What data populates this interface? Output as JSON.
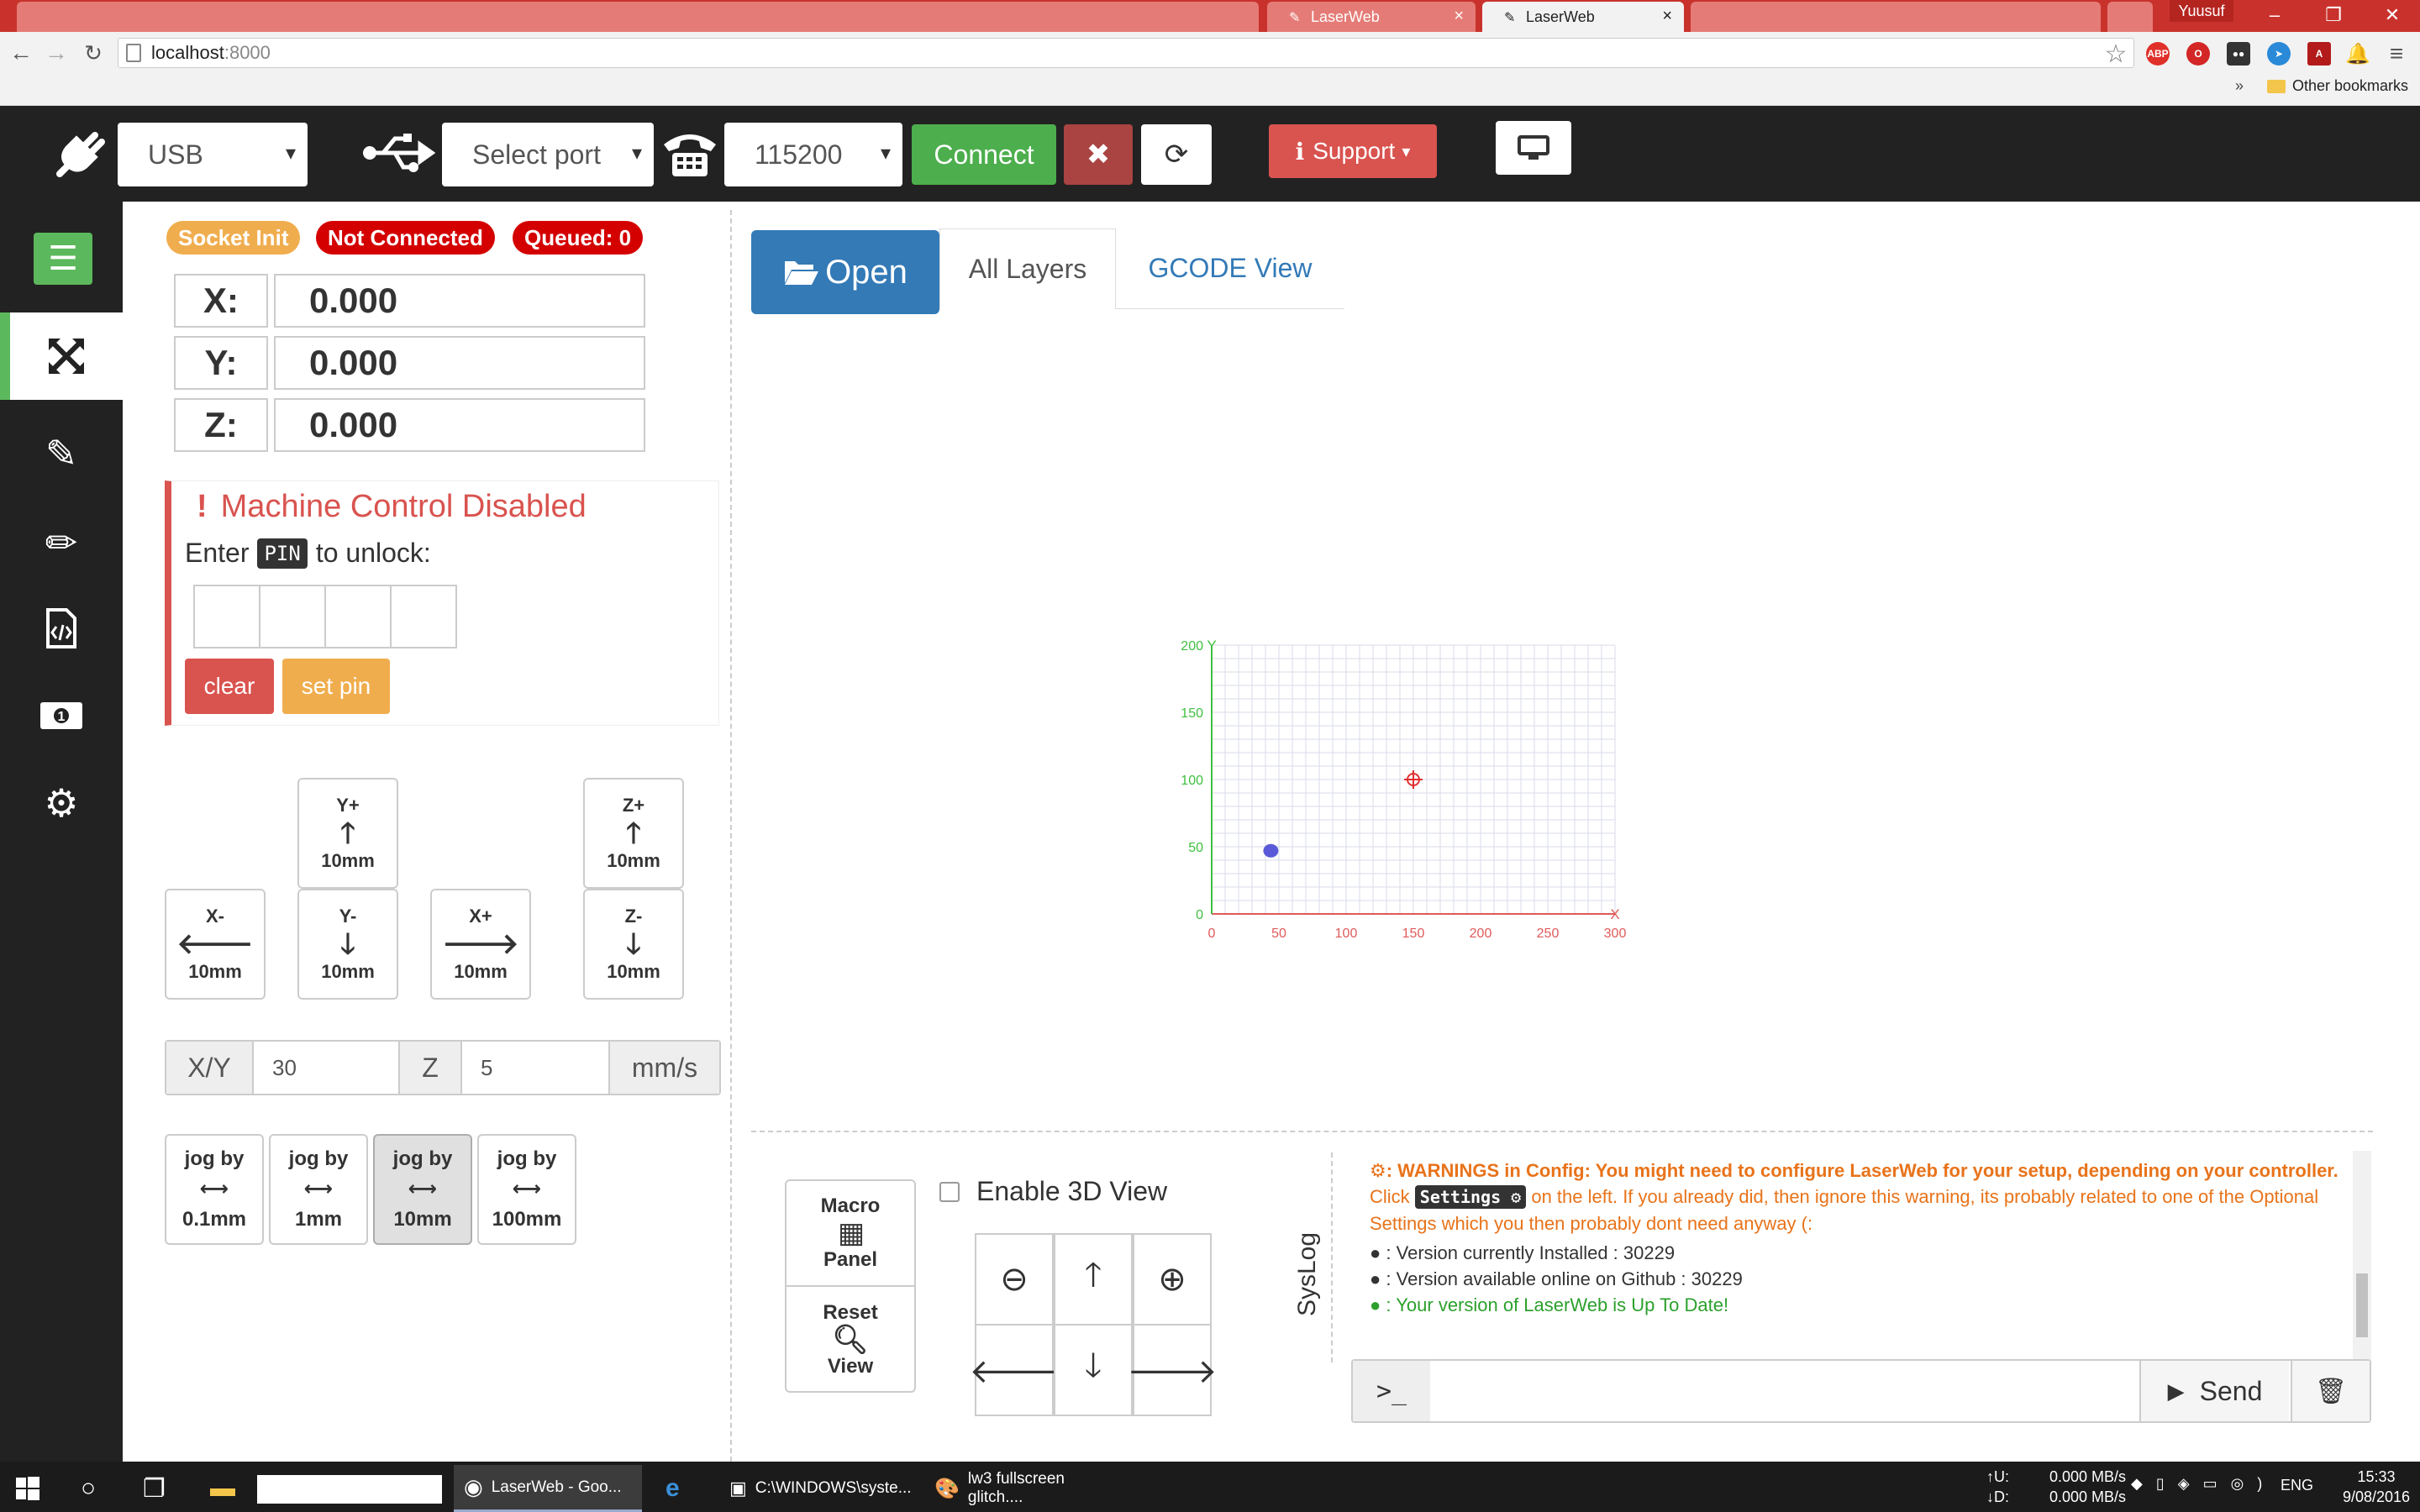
{
  "browser": {
    "profile": "Yuusuf",
    "tabs": [
      {
        "title": ""
      },
      {
        "title": "LaserWeb"
      },
      {
        "title": "LaserWeb"
      },
      {
        "title": ""
      }
    ],
    "url_host": "localhost",
    "url_port": ":8000",
    "other_bookmarks": "Other bookmarks",
    "extensions": [
      "ABP"
    ]
  },
  "topbar": {
    "connection_type": "USB",
    "port": "Select port",
    "baud": "115200",
    "connect_label": "Connect",
    "support_label": "Support"
  },
  "status": {
    "socket": "Socket Init",
    "connection": "Not Connected",
    "queued": "Queued: 0"
  },
  "dro": {
    "x_label": "X:",
    "x_value": "0.000",
    "y_label": "Y:",
    "y_value": "0.000",
    "z_label": "Z:",
    "z_value": "0.000"
  },
  "lock": {
    "title": "Machine Control Disabled",
    "prompt_pre": "Enter",
    "pin_tag": "PIN",
    "prompt_post": "to unlock:",
    "clear_label": "clear",
    "setpin_label": "set pin"
  },
  "jog": {
    "y_plus": {
      "axis": "Y+",
      "dist": "10mm"
    },
    "z_plus": {
      "axis": "Z+",
      "dist": "10mm"
    },
    "x_minus": {
      "axis": "X-",
      "dist": "10mm"
    },
    "y_minus": {
      "axis": "Y-",
      "dist": "10mm"
    },
    "x_plus": {
      "axis": "X+",
      "dist": "10mm"
    },
    "z_minus": {
      "axis": "Z-",
      "dist": "10mm"
    }
  },
  "speed": {
    "xy_label": "X/Y",
    "xy_value": "30",
    "z_label": "Z",
    "z_value": "5",
    "unit": "mm/s"
  },
  "jogby": {
    "label": "jog by",
    "options": [
      "0.1mm",
      "1mm",
      "10mm",
      "100mm"
    ],
    "selected": "10mm"
  },
  "main_tabs": {
    "open_label": "Open",
    "all_layers": "All Layers",
    "gcode_view": "GCODE View"
  },
  "chart_data": {
    "type": "scatter",
    "x_axis_label": "X",
    "y_axis_label": "Y",
    "xlim": [
      0,
      300
    ],
    "ylim": [
      0,
      200
    ],
    "x_ticks": [
      "0",
      "50",
      "100",
      "150",
      "200",
      "250",
      "300"
    ],
    "y_ticks": [
      "0",
      "50",
      "100",
      "150",
      "200"
    ],
    "grid": true,
    "x_axis_color": "#e05a5a",
    "y_axis_color": "#3fbf3f",
    "markers": [
      {
        "name": "crosshair",
        "x": 150,
        "y": 100,
        "color": "#e03030"
      },
      {
        "name": "blob",
        "x": 44,
        "y": 47,
        "color": "#5a5ad8"
      }
    ]
  },
  "bottom": {
    "macro_label": "Macro",
    "panel_label": "Panel",
    "reset_label": "Reset",
    "view_label": "View",
    "enable3d_label": "Enable 3D View",
    "syslog_label": "SysLog"
  },
  "log": {
    "warn_bold": ": WARNINGS in Config: You might need to configure LaserWeb for your setup, depending on your controller.",
    "warn_click": "Click",
    "settings_tag": "Settings",
    "warn_rest": "on the left. If you already did, then ignore this warning, its probably related to one of the Optional Settings which you then probably dont need anyway (:",
    "installed": ": Version currently Installed : 30229",
    "available": ": Version available online on Github : 30229",
    "uptodate": ": Your version of LaserWeb is Up To Date!"
  },
  "console": {
    "prompt": ">_",
    "send_label": "Send"
  },
  "taskbar": {
    "items": [
      "LaserWeb - Goo...",
      "C:\\WINDOWS\\syste...",
      "lw3 fullscreen glitch...."
    ],
    "upload_label": "U:",
    "download_label": "D:",
    "upload_rate": "0.000 MB/s",
    "download_rate": "0.000 MB/s",
    "lang": "ENG",
    "time": "15:33",
    "date": "9/08/2016"
  },
  "colors": {
    "success": "#5cb85c",
    "danger": "#d9534f",
    "warning": "#f0ad4e",
    "primary": "#337ab7",
    "dark": "#222222"
  }
}
